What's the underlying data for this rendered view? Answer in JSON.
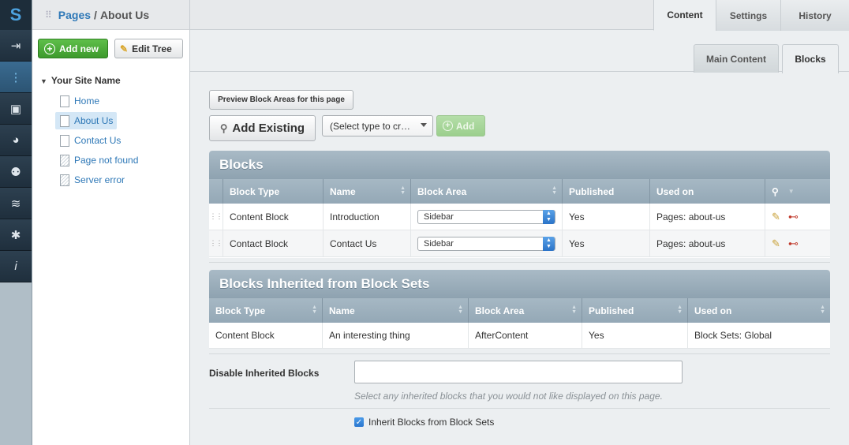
{
  "rail": {
    "logo": "S",
    "icons": [
      "logout-icon",
      "sitetree-icon",
      "image-icon",
      "reports-icon",
      "users-icon",
      "database-icon",
      "settings-icon",
      "info-icon"
    ]
  },
  "header": {
    "crumb": "Pages",
    "sep": "/",
    "current": "About Us"
  },
  "top_tabs": [
    "Content",
    "Settings",
    "History"
  ],
  "sub_tabs": [
    "Main Content",
    "Blocks"
  ],
  "tree": {
    "add_new": "Add new",
    "edit_tree": "Edit Tree",
    "site_name": "Your Site Name",
    "pages": [
      "Home",
      "About Us",
      "Contact Us",
      "Page not found",
      "Server error"
    ]
  },
  "toolbar": {
    "preview": "Preview Block Areas for this page",
    "add_existing": "Add Existing",
    "type_select": "(Select type to cr…",
    "add": "Add"
  },
  "blocks": {
    "title": "Blocks",
    "columns": [
      "Block Type",
      "Name",
      "Block Area",
      "Published",
      "Used on"
    ],
    "rows": [
      {
        "type": "Content Block",
        "name": "Introduction",
        "area": "Sidebar",
        "published": "Yes",
        "used": "Pages: about-us"
      },
      {
        "type": "Contact Block",
        "name": "Contact Us",
        "area": "Sidebar",
        "published": "Yes",
        "used": "Pages: about-us"
      }
    ]
  },
  "inherited": {
    "title": "Blocks Inherited from Block Sets",
    "columns": [
      "Block Type",
      "Name",
      "Block Area",
      "Published",
      "Used on"
    ],
    "rows": [
      {
        "type": "Content Block",
        "name": "An interesting thing",
        "area": "AfterContent",
        "published": "Yes",
        "used": "Block Sets: Global"
      }
    ]
  },
  "disable": {
    "label": "Disable Inherited Blocks",
    "hint": "Select any inherited blocks that you would not like displayed on this page.",
    "checkbox_label": "Inherit Blocks from Block Sets",
    "checked": true
  }
}
